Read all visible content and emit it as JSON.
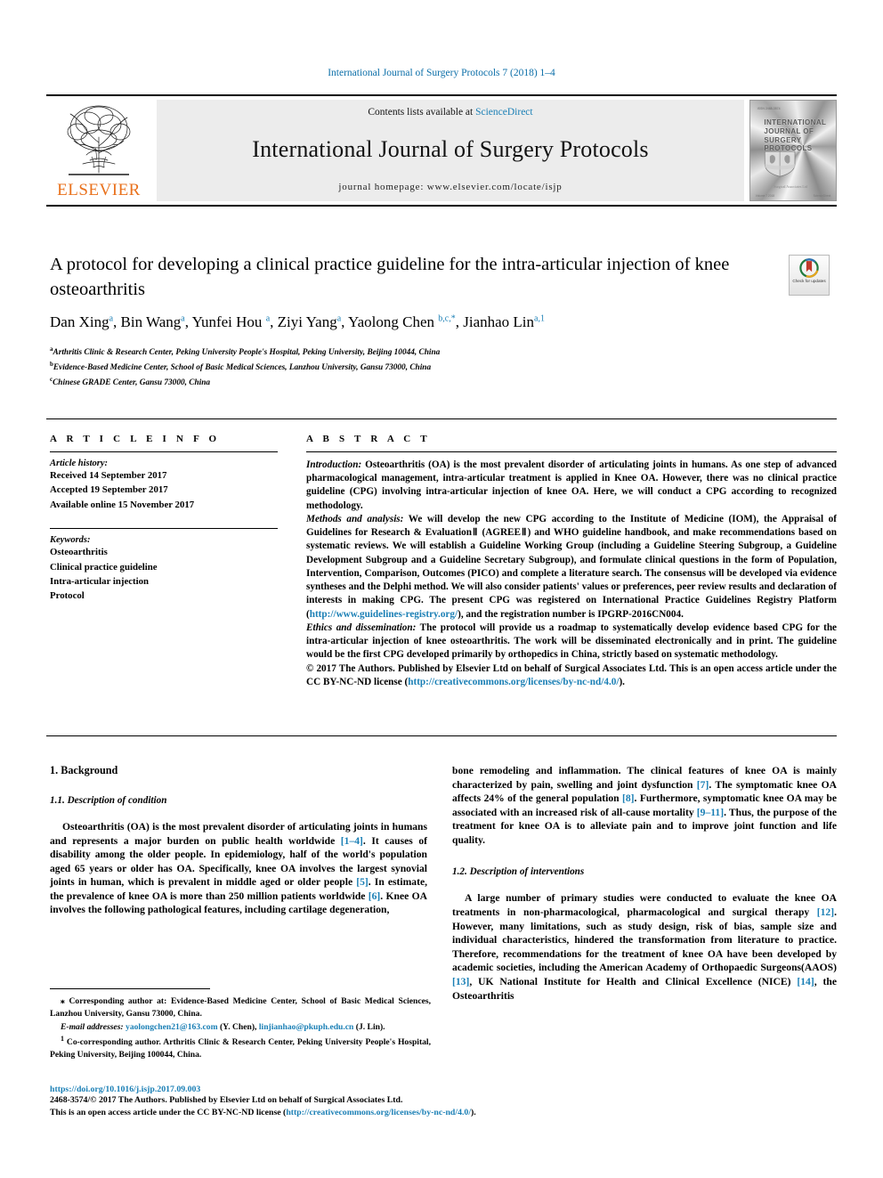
{
  "running_head": "International Journal of Surgery Protocols 7 (2018) 1–4",
  "masthead": {
    "publisher_name": "ELSEVIER",
    "contents_prefix": "Contents lists available at ",
    "contents_link": "ScienceDirect",
    "journal_title": "International Journal of Surgery Protocols",
    "homepage_line": "journal homepage: www.elsevier.com/locate/isjp",
    "cover": {
      "title_lines": [
        "INTERNATIONAL",
        "JOURNAL OF",
        "SURGERY",
        "PROTOCOLS"
      ],
      "corner_text": "ISSN 2468-3574",
      "ribbon_text": "Surgical Associates Ltd",
      "foot_left": "Volume 7  2018",
      "foot_right": "ScienceDirect"
    }
  },
  "article": {
    "title": "A protocol for developing a clinical practice guideline for the intra-articular injection of knee osteoarthritis",
    "crossmark_label": "Check for updates",
    "authors_html": "Dan Xing<sup>a</sup>, Bin Wang<sup>a</sup>, Yunfei Hou <sup>a</sup>, Ziyi Yang<sup>a</sup>, Yaolong Chen <sup>b,c,</sup><sup>*</sup>, Jianhao Lin<sup>a,1</sup>",
    "affiliations": [
      {
        "marker": "a",
        "text": "Arthritis Clinic & Research Center, Peking University People's Hospital, Peking University, Beijing 10044, China"
      },
      {
        "marker": "b",
        "text": "Evidence-Based Medicine Center, School of Basic Medical Sciences, Lanzhou University, Gansu 73000, China"
      },
      {
        "marker": "c",
        "text": "Chinese GRADE Center, Gansu 73000, China"
      }
    ]
  },
  "article_info": {
    "heading": "A R T I C L E    I N F O",
    "history_label": "Article history:",
    "history": [
      "Received 14 September 2017",
      "Accepted 19 September 2017",
      "Available online 15 November 2017"
    ],
    "keywords_label": "Keywords:",
    "keywords": [
      "Osteoarthritis",
      "Clinical practice guideline",
      "Intra-articular injection",
      "Protocol"
    ]
  },
  "abstract": {
    "heading": "A B S T R A C T",
    "paragraphs": [
      {
        "lead": "Introduction:",
        "text": " Osteoarthritis (OA) is the most prevalent disorder of articulating joints in humans. As one step of advanced pharmacological management, intra-articular treatment is applied in Knee OA. However, there was no clinical practice guideline (CPG) involving intra-articular injection of knee OA. Here, we will conduct a CPG according to recognized methodology."
      },
      {
        "lead": "Methods and analysis:",
        "text": " We will develop the new CPG according to the Institute of Medicine (IOM), the Appraisal of Guidelines for Research & EvaluationⅡ (AGREEⅡ) and WHO guideline handbook, and make recommendations based on systematic reviews. We will establish a Guideline Working Group (including a Guideline Steering Subgroup, a Guideline Development Subgroup and a Guideline Secretary Subgroup), and formulate clinical questions in the form of Population, Intervention, Comparison, Outcomes (PICO) and complete a literature search. The consensus will be developed via evidence syntheses and the Delphi method. We will also consider patients' values or preferences, peer review results and declaration of interests in making CPG. The present CPG was registered on International Practice Guidelines Registry Platform (",
        "link": "http://www.guidelines-registry.org/",
        "text_after": "), and the registration number is IPGRP-2016CN004."
      },
      {
        "lead": " Ethics and dissemination:",
        "text": " The protocol will provide us a roadmap to systematically develop evidence based CPG for the intra-articular injection of knee osteoarthritis. The work will be disseminated electronically and in print. The guideline would be the first CPG developed primarily by orthopedics in China, strictly based on systematic methodology."
      }
    ],
    "copyright_text": "© 2017 The Authors. Published by Elsevier Ltd on behalf of Surgical Associates Ltd. This is an open access article under the CC BY-NC-ND license (",
    "copyright_link": "http://creativecommons.org/licenses/by-nc-nd/4.0/",
    "copyright_after": ")."
  },
  "body": {
    "left": {
      "section_heading": "1. Background",
      "sub_heading": "1.1. Description of condition",
      "paragraph_1_a": "Osteoarthritis (OA) is the most prevalent disorder of articulating joints in humans and represents a major burden on public health worldwide ",
      "ref_1_4": "[1–4]",
      "paragraph_1_b": ". It causes of disability among the older people. In epidemiology, half of the world's population aged 65 years or older has OA. Specifically, knee OA involves the largest synovial joints in human, which is prevalent in middle aged or older people ",
      "ref_5": "[5]",
      "paragraph_1_c": ". In estimate, the prevalence of knee OA is more than 250 million patients worldwide ",
      "ref_6": "[6]",
      "paragraph_1_d": ". Knee OA involves the following pathological features, including cartilage degeneration,"
    },
    "right": {
      "paragraph_1_a": "bone remodeling and inflammation. The clinical features of knee OA is mainly characterized by pain, swelling and joint dysfunction ",
      "ref_7": "[7]",
      "paragraph_1_b": ". The symptomatic knee OA affects 24% of the general population ",
      "ref_8": "[8]",
      "paragraph_1_c": ". Furthermore, symptomatic knee OA may be associated with an increased risk of all-cause mortality ",
      "ref_9_11": "[9–11]",
      "paragraph_1_d": ". Thus, the purpose of the treatment for knee OA is to alleviate pain and to improve joint function and life quality.",
      "sub_heading": "1.2. Description of interventions",
      "paragraph_2_a": "A large number of primary studies were conducted to evaluate the knee OA treatments in non-pharmacological, pharmacological and surgical therapy ",
      "ref_12": "[12]",
      "paragraph_2_b": ". However, many limitations, such as study design, risk of bias, sample size and individual characteristics, hindered the transformation from literature to practice. Therefore, recommendations for the treatment of knee OA have been developed by academic societies, including the American Academy of Orthopaedic Surgeons(AAOS) ",
      "ref_13": "[13]",
      "paragraph_2_c": ", UK National Institute for Health and Clinical Excellence (NICE) ",
      "ref_14": "[14]",
      "paragraph_2_d": ", the Osteoarthritis"
    }
  },
  "footnotes": {
    "corresponding_marker": "⁎",
    "corresponding": " Corresponding author at: Evidence-Based Medicine Center, School of Basic Medical Sciences, Lanzhou University, Gansu 73000, China.",
    "email_label": "E-mail addresses:",
    "email_1": "yaolongchen21@163.com",
    "email_1_owner": " (Y. Chen), ",
    "email_2": "linjianhao@pkuph.edu.cn",
    "email_2_owner": " (J. Lin).",
    "co_corresponding_marker": "1",
    "co_corresponding": " Co-corresponding author. Arthritis Clinic & Research Center, Peking University People's Hospital, Peking University, Beijing 100044, China."
  },
  "bottom": {
    "doi": "https://doi.org/10.1016/j.isjp.2017.09.003",
    "line_1": "2468-3574/© 2017 The Authors. Published by Elsevier Ltd on behalf of Surgical Associates Ltd.",
    "line_2_a": "This is an open access article under the CC BY-NC-ND license (",
    "line_2_link": "http://creativecommons.org/licenses/by-nc-nd/4.0/",
    "line_2_b": ")."
  },
  "colors": {
    "link": "#1a7fb5",
    "elsevier_orange": "#E9711C",
    "band_gray": "#ececec"
  }
}
